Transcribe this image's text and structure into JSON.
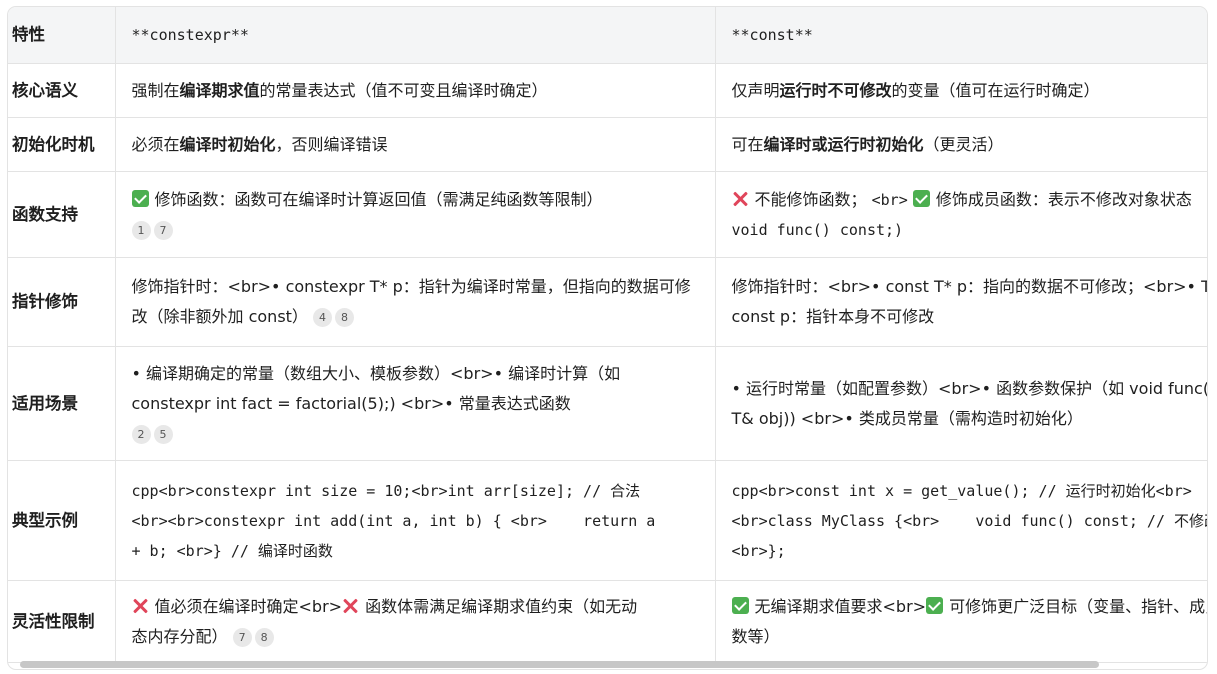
{
  "headers": {
    "feature": "特性",
    "constexpr": "**constexpr**",
    "const": "**const**"
  },
  "rows": [
    {
      "feature": "核心语义",
      "constexpr": {
        "pre": "强制在",
        "bold": "编译期求值",
        "post": "的常量表达式（值不可变且编译时确定）"
      },
      "const": {
        "pre": "仅声明",
        "bold": "运行时不可修改",
        "post": "的变量（值可在运行时确定）"
      }
    },
    {
      "feature": "初始化时机",
      "constexpr": {
        "pre": "必须在",
        "bold": "编译时初始化",
        "post": "，否则编译错误"
      },
      "const": {
        "pre": "可在",
        "bold": "编译时或运行时初始化",
        "post": "（更灵活）"
      }
    },
    {
      "feature": "函数支持",
      "constexpr": {
        "text": "修饰函数：函数可在编译时计算返回值（需满足纯函数等限制）",
        "cites": [
          "1",
          "7"
        ]
      },
      "const": {
        "text1": "不能修饰函数；",
        "br": "<br>",
        "text2": "修饰成员函数：表示不修改对象状态",
        "code": "void func() const;)"
      }
    },
    {
      "feature": "指针修饰",
      "constexpr": {
        "text": "修饰指针时：<br>• constexpr T* p：指针为编译时常量，但指向的数据可修改（除非额外加 const）",
        "cites": [
          "4",
          "8"
        ]
      },
      "const": {
        "line1": "修饰指针时：<br>• const T* p：指向的数据不可修改；<br>• T*",
        "line2": "const p：指针本身不可修改"
      }
    },
    {
      "feature": "适用场景",
      "constexpr": {
        "line1": "• 编译期确定的常量（数组大小、模板参数）<br>• 编译时计算（如",
        "line2": "constexpr int fact = factorial(5);) <br>• 常量表达式函数",
        "cites": [
          "2",
          "5"
        ]
      },
      "const": {
        "line1": "• 运行时常量（如配置参数）<br>• 函数参数保护（如 void func(const",
        "line2": "T& obj)) <br>• 类成员常量（需构造时初始化）"
      }
    },
    {
      "feature": "典型示例",
      "constexpr": {
        "line1": "cpp<br>constexpr int size = 10;<br>int arr[size]; // 合法",
        "line2": "<br><br>constexpr int add(int a, int b) { <br>    return a",
        "line3": "+ b; <br>} // 编译时函数"
      },
      "const": {
        "line1": "cpp<br>const int x = get_value(); // 运行时初始化<br>",
        "line2": "<br>class MyClass {<br>    void func() const; // 不修改成员",
        "line3": "<br>};"
      }
    },
    {
      "feature": "灵活性限制",
      "constexpr": {
        "text1": "值必须在编译时确定<br>",
        "text2": "函数体需满足编译期求值约束（如无动",
        "text3": "态内存分配）",
        "cites": [
          "7",
          "8"
        ]
      },
      "const": {
        "text1": "无编译期求值要求<br>",
        "text2": "可修饰更广泛目标（变量、指针、成员函",
        "text3": "数等）"
      }
    }
  ],
  "colors": {
    "header_bg": "#f4f5f6",
    "check": "#4caf50",
    "cross": "#e0455a",
    "border": "#e3e3e3"
  }
}
